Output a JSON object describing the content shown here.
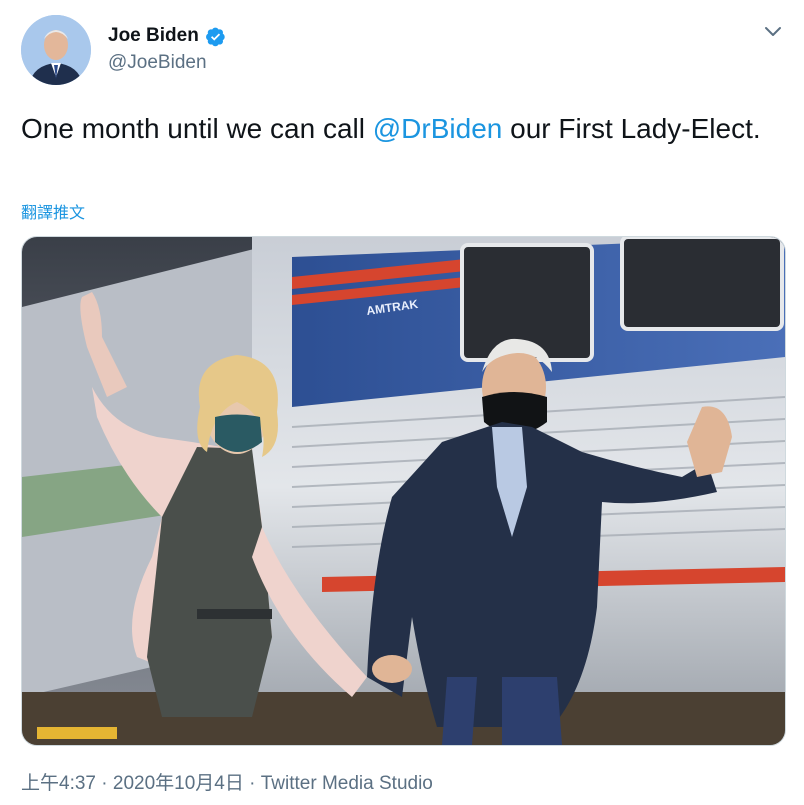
{
  "author": {
    "name": "Joe Biden",
    "handle": "@JoeBiden",
    "verified_icon": "verified-badge-icon",
    "verified_color": "#1d9bf0"
  },
  "tweet": {
    "text_before": "One month until we can call ",
    "mention": "@DrBiden",
    "text_after": " our First Lady-Elect.",
    "translate_label": "翻譯推文"
  },
  "media": {
    "alt": "Photo of Joe Biden and Jill Biden waving in front of an Amtrak train",
    "logo_text": "AMTRAK"
  },
  "meta": {
    "time": "上午4:37",
    "sep1": " · ",
    "date": "2020年10月4日",
    "sep2": " · ",
    "source": "Twitter Media Studio"
  },
  "colors": {
    "link": "#1b95e0",
    "secondary": "#5b7083",
    "primary_text": "#0f1419"
  }
}
